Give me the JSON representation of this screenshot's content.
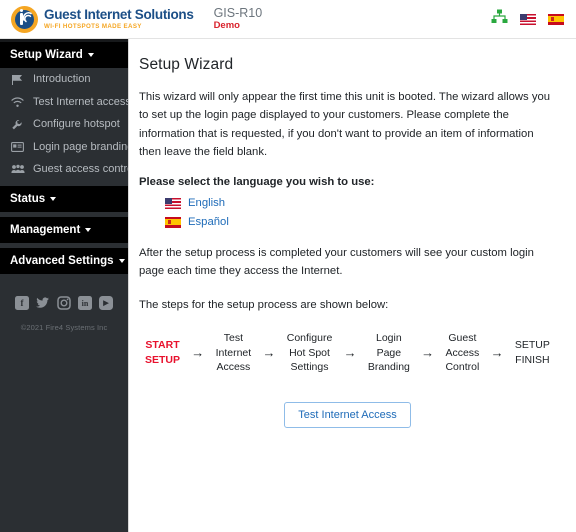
{
  "header": {
    "logo_title": "Guest Internet Solutions",
    "logo_tagline": "WI-FI HOTSPOTS MADE EASY",
    "unit_model": "GIS-R10",
    "unit_mode": "Demo",
    "icons": {
      "network": "network-sitemap-icon",
      "flag_us": "us-flag-icon",
      "flag_es": "spain-flag-icon"
    }
  },
  "sidebar": {
    "sections": [
      {
        "label": "Setup Wizard"
      },
      {
        "label": "Status"
      },
      {
        "label": "Management"
      },
      {
        "label": "Advanced Settings"
      }
    ],
    "items": [
      {
        "label": "Introduction",
        "icon": "flag-icon"
      },
      {
        "label": "Test Internet access",
        "icon": "wifi-icon"
      },
      {
        "label": "Configure hotspot",
        "icon": "wrench-icon"
      },
      {
        "label": "Login page branding",
        "icon": "id-card-icon"
      },
      {
        "label": "Guest access control",
        "icon": "users-icon"
      }
    ],
    "social": [
      {
        "name": "facebook-icon",
        "glyph": "f"
      },
      {
        "name": "twitter-icon",
        "glyph": "✈"
      },
      {
        "name": "instagram-icon",
        "glyph": "□"
      },
      {
        "name": "linkedin-icon",
        "glyph": "in"
      },
      {
        "name": "youtube-icon",
        "glyph": "▶"
      }
    ],
    "copyright": "©2021 Fire4 Systems Inc"
  },
  "main": {
    "title": "Setup Wizard",
    "intro_paragraph": "This wizard will only appear the first time this unit is booted. The wizard allows you to set up the login page displayed to your customers. Please complete the information that is requested, if you don't want to provide an item of information then leave the field blank.",
    "language_heading": "Please select the language you wish to use:",
    "languages": [
      {
        "label": "English",
        "flag": "us-flag-icon"
      },
      {
        "label": "Español",
        "flag": "spain-flag-icon"
      }
    ],
    "after_setup_paragraph": "After the setup process is completed your customers will see your custom login page each time they access the Internet.",
    "steps_intro": "The steps for the setup process are shown below:",
    "steps": [
      {
        "label": "START\nSETUP",
        "accent": true
      },
      {
        "label": "Test\nInternet\nAccess",
        "accent": false
      },
      {
        "label": "Configure\nHot Spot\nSettings",
        "accent": false
      },
      {
        "label": "Login\nPage\nBranding",
        "accent": false
      },
      {
        "label": "Guest\nAccess\nControl",
        "accent": false
      },
      {
        "label": "SETUP\nFINISH",
        "accent": false
      }
    ],
    "arrow_glyph": "→",
    "test_button_label": "Test Internet Access"
  },
  "colors": {
    "brand_blue": "#1c4f87",
    "brand_orange": "#f5a623",
    "accent_red": "#e8112d",
    "demo_red": "#d9232d",
    "link_blue": "#1e6bb8",
    "sidebar_bg": "#2b2f33",
    "sidebar_section_bg": "#000000"
  }
}
